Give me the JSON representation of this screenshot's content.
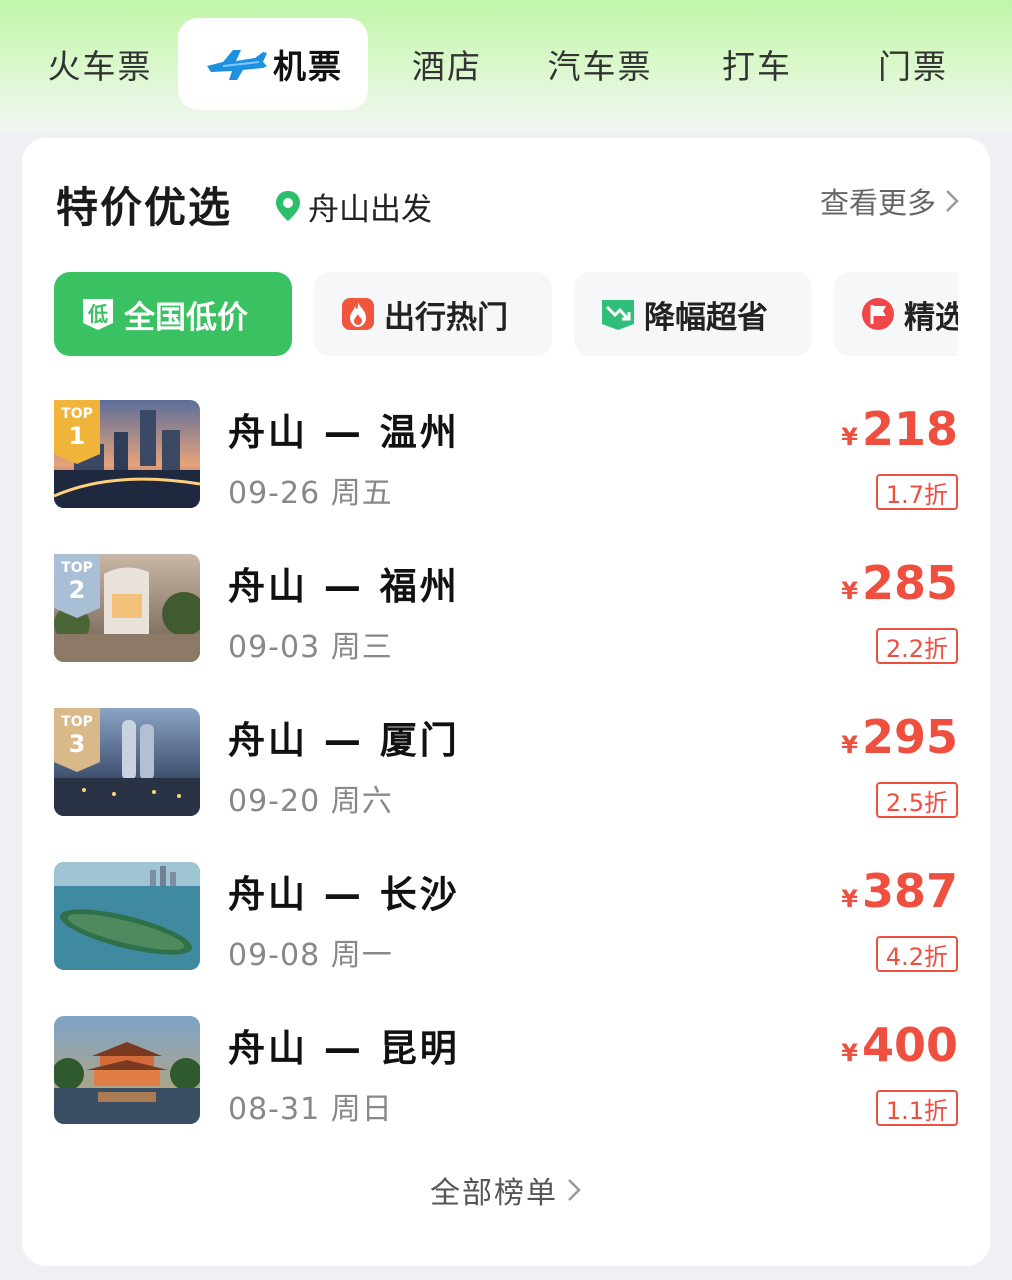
{
  "tabs": [
    {
      "label": "火车票"
    },
    {
      "label": "机票"
    },
    {
      "label": "酒店"
    },
    {
      "label": "汽车票"
    },
    {
      "label": "打车"
    },
    {
      "label": "门票"
    }
  ],
  "active_tab": "机票",
  "section": {
    "title": "特价优选",
    "location": "舟山出发",
    "more_label": "查看更多"
  },
  "filters": [
    {
      "label": "全国低价",
      "icon": "low-price-icon",
      "icon_text": "低"
    },
    {
      "label": "出行热门",
      "icon": "fire-icon"
    },
    {
      "label": "降幅超省",
      "icon": "price-drop-icon"
    },
    {
      "label": "精选",
      "icon": "flag-icon"
    }
  ],
  "routes": [
    {
      "route": "舟山 — 温州",
      "date": "09-26 周五",
      "currency": "¥",
      "price": "218",
      "discount": "1.7折",
      "rank": "1",
      "rank_label": "TOP"
    },
    {
      "route": "舟山 — 福州",
      "date": "09-03 周三",
      "currency": "¥",
      "price": "285",
      "discount": "2.2折",
      "rank": "2",
      "rank_label": "TOP"
    },
    {
      "route": "舟山 — 厦门",
      "date": "09-20 周六",
      "currency": "¥",
      "price": "295",
      "discount": "2.5折",
      "rank": "3",
      "rank_label": "TOP"
    },
    {
      "route": "舟山 — 长沙",
      "date": "09-08 周一",
      "currency": "¥",
      "price": "387",
      "discount": "4.2折"
    },
    {
      "route": "舟山 — 昆明",
      "date": "08-31 周日",
      "currency": "¥",
      "price": "400",
      "discount": "1.1折"
    }
  ],
  "all_list_label": "全部榜单",
  "colors": {
    "accent_green": "#39c162",
    "price_red": "#ef4f3f",
    "rank1_gold": "#f0b43a",
    "rank2_silver": "#a9bfd6",
    "rank3_bronze": "#d9b98a"
  }
}
